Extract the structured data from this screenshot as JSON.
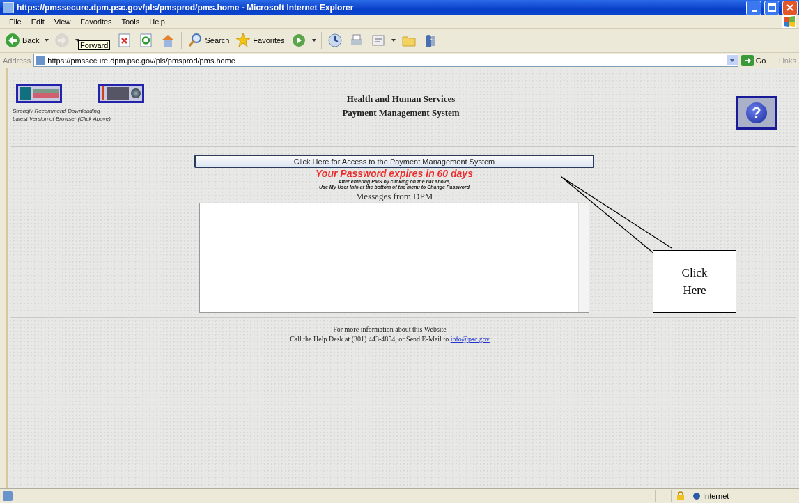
{
  "window": {
    "title": "https://pmssecure.dpm.psc.gov/pls/pmsprod/pms.home - Microsoft Internet Explorer"
  },
  "menu": [
    "File",
    "Edit",
    "View",
    "Favorites",
    "Tools",
    "Help"
  ],
  "toolbar": [
    {
      "kind": "back",
      "label": "Back",
      "disabled": false
    },
    {
      "kind": "forward",
      "disabled": true
    },
    {
      "kind": "stop",
      "disabled": false
    },
    {
      "kind": "refresh",
      "disabled": false
    },
    {
      "kind": "home",
      "disabled": false
    },
    {
      "kind": "search",
      "label": "Search",
      "disabled": false
    },
    {
      "kind": "favorites",
      "label": "Favorites",
      "disabled": false
    },
    {
      "kind": "media",
      "disabled": false
    },
    {
      "kind": "history",
      "disabled": false
    },
    {
      "kind": "print",
      "disabled": false
    },
    {
      "kind": "edit",
      "disabled": false
    },
    {
      "kind": "folder",
      "disabled": false
    },
    {
      "kind": "messenger",
      "disabled": false
    }
  ],
  "tooltip": "Forward",
  "address": {
    "label": "Address",
    "value": "https://pmssecure.dpm.psc.gov/pls/pmsprod/pms.home",
    "go": "Go",
    "links": "Links"
  },
  "page": {
    "browser_note": [
      "Strongly Recommend Downloading",
      "Latest Version of Browser (Click Above)"
    ],
    "title": [
      "Health and Human Services",
      "Payment Management System"
    ],
    "access_button": "Click Here for Access to the Payment Management System",
    "password_warning": "Your Password expires in 60 days",
    "instructions": [
      "After entering PMS by clicking on the bar above,",
      "Use My User Info at the bottom of the menu to Change Password"
    ],
    "messages_heading": "Messages from DPM",
    "help_button": "?",
    "footer": {
      "line_1": "For more information about this Website",
      "line_2": "Call the Help Desk at (301) 443-4854, or Send E-Mail to",
      "email_link": "info@psc.gov"
    }
  },
  "callout": "Click Here",
  "status_bar": {
    "zone": "Internet"
  }
}
